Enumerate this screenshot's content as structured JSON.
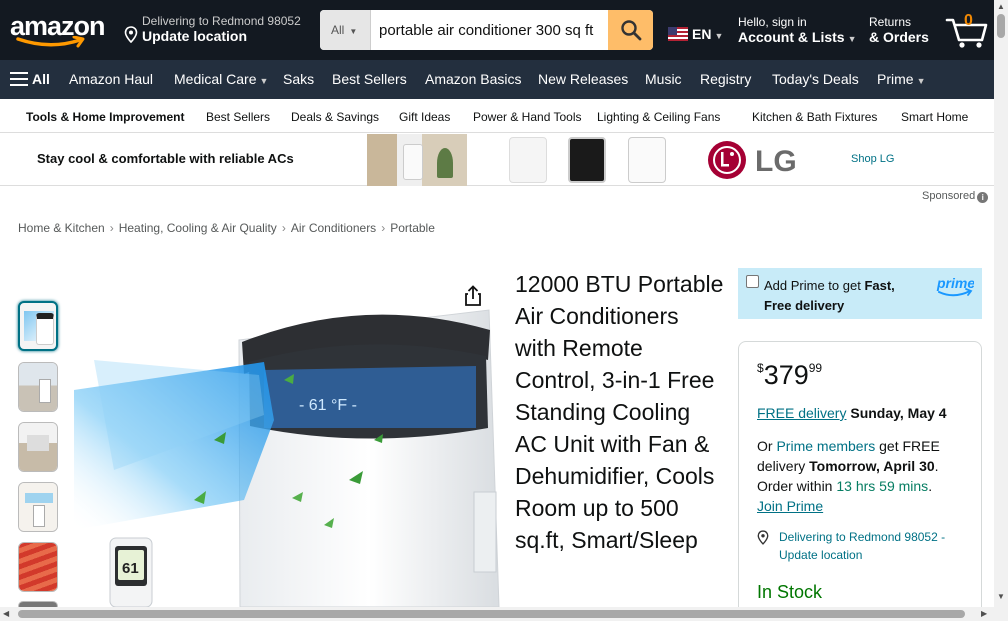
{
  "header": {
    "logo_text": "amazon",
    "deliver_line1": "Delivering to Redmond 98052",
    "deliver_line2": "Update location",
    "search_category": "All",
    "search_value": "portable air conditioner 300 sq ft",
    "lang": "EN",
    "account_line1": "Hello, sign in",
    "account_line2": "Account & Lists",
    "returns_line1": "Returns",
    "returns_line2": "& Orders",
    "cart_count": "0"
  },
  "main_nav": {
    "all": "All",
    "items": [
      "Amazon Haul",
      "Medical Care",
      "Saks",
      "Best Sellers",
      "Amazon Basics",
      "New Releases",
      "Music",
      "Registry",
      "Today's Deals",
      "Prime"
    ]
  },
  "sub_nav": {
    "items": [
      "Tools & Home Improvement",
      "Best Sellers",
      "Deals & Savings",
      "Gift Ideas",
      "Power & Hand Tools",
      "Lighting & Ceiling Fans",
      "Kitchen & Bath Fixtures",
      "Smart Home"
    ]
  },
  "banner": {
    "headline": "Stay cool & comfortable with reliable ACs",
    "brand": "LG",
    "cta": "Shop LG",
    "sponsored": "Sponsored"
  },
  "breadcrumb": [
    "Home & Kitchen",
    "Heating, Cooling & Air Quality",
    "Air Conditioners",
    "Portable"
  ],
  "product": {
    "title": "12000 BTU Portable Air Conditioners with Remote Control, 3-in-1 Free Standing Cooling AC Unit with Fan & Dehumidifier, Cools Room up to 500 sq.ft, Smart/Sleep",
    "remote_display": "61"
  },
  "buybox": {
    "prime_text_pre": "Add Prime to get ",
    "prime_text_bold": "Fast, Free delivery",
    "prime_logo": "prime",
    "price_symbol": "$",
    "price_whole": "379",
    "price_fraction": "99",
    "free_delivery": "FREE delivery",
    "delivery_date": "Sunday, May 4",
    "or_text": "Or ",
    "prime_members": "Prime members",
    "get_free": " get FREE delivery ",
    "fast_date": "Tomorrow, April 30",
    "order_within": ". Order within ",
    "countdown": "13 hrs 59 mins",
    "period": ".",
    "join_prime": "Join Prime",
    "deliver_to": "Delivering to Redmond 98052 - Update location",
    "stock": "In Stock"
  },
  "colors": {
    "nav_dark": "#131921",
    "nav_secondary": "#232f3e",
    "search_button": "#febd69",
    "link": "#007185",
    "in_stock": "#007600",
    "prime_bg": "#c8ebf8"
  }
}
